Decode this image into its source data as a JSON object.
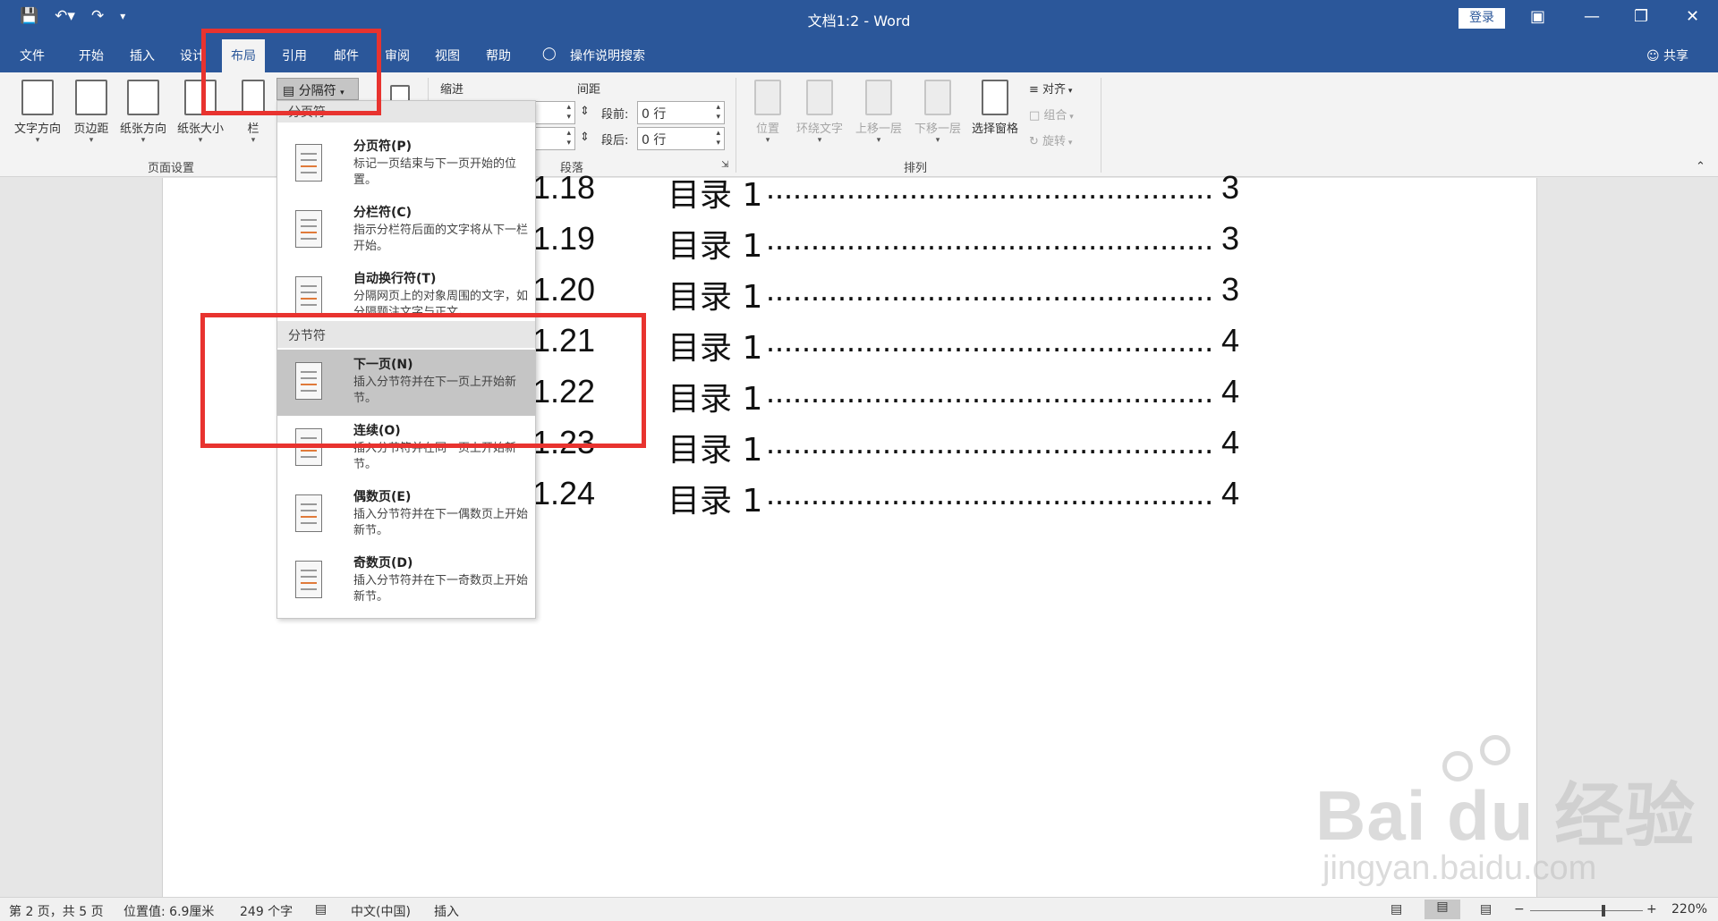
{
  "title_bar": {
    "doc_title": "文档1:2 - Word",
    "login_label": "登录",
    "qat_save_icon": "save-icon",
    "qat_undo_icon": "undo-icon",
    "qat_redo_icon": "redo-icon",
    "qat_customize_icon": "customize-icon",
    "ribbon_display_icon": "ribbon-display-icon",
    "minimize_icon": "minimize-icon",
    "restore_icon": "restore-icon",
    "close_icon": "close-icon"
  },
  "tabs": [
    {
      "label": "文件"
    },
    {
      "label": "开始"
    },
    {
      "label": "插入"
    },
    {
      "label": "设计"
    },
    {
      "label": "布局"
    },
    {
      "label": "引用"
    },
    {
      "label": "邮件"
    },
    {
      "label": "审阅"
    },
    {
      "label": "视图"
    },
    {
      "label": "帮助"
    },
    {
      "label": "操作说明搜索"
    }
  ],
  "active_tab": "布局",
  "share_label": "共享",
  "ribbon": {
    "page_setup": {
      "text_direction": "文字方向",
      "margins": "页边距",
      "orientation": "纸张方向",
      "size": "纸张大小",
      "columns": "栏",
      "group_label": "页面设置",
      "breaks_label": "分隔符"
    },
    "paragraph": {
      "indent_label": "缩进",
      "spacing_label": "间距",
      "before_label": "段前:",
      "after_label": "段后:",
      "before_value": "0 行",
      "after_value": "0 行",
      "group_label": "段落"
    },
    "arrange": {
      "position": "位置",
      "wrap_text": "环绕文字",
      "bring_forward": "上移一层",
      "send_backward": "下移一层",
      "selection_pane": "选择窗格",
      "align": "对齐",
      "group": "组合",
      "rotate": "旋转",
      "group_label": "排列"
    }
  },
  "breaks_menu": {
    "page_breaks_header": "分页符",
    "section_breaks_header": "分节符",
    "items": [
      {
        "title": "分页符(P)",
        "desc": "标记一页结束与下一页开始的位置。"
      },
      {
        "title": "分栏符(C)",
        "desc": "指示分栏符后面的文字将从下一栏开始。"
      },
      {
        "title": "自动换行符(T)",
        "desc": "分隔网页上的对象周围的文字，如分隔题注文字与正文。"
      },
      {
        "title": "下一页(N)",
        "desc": "插入分节符并在下一页上开始新节。"
      },
      {
        "title": "连续(O)",
        "desc": "插入分节符并在同一页上开始新节。"
      },
      {
        "title": "偶数页(E)",
        "desc": "插入分节符并在下一偶数页上开始新节。"
      },
      {
        "title": "奇数页(D)",
        "desc": "插入分节符并在下一奇数页上开始新节。"
      }
    ]
  },
  "document": {
    "toc_rows": [
      {
        "num": "1.18",
        "title": "目录 1",
        "dots": "...........................................................",
        "page": "3"
      },
      {
        "num": "1.19",
        "title": "目录 1",
        "dots": "...........................................................",
        "page": "3"
      },
      {
        "num": "1.20",
        "title": "目录 1",
        "dots": "...........................................................",
        "page": "3"
      },
      {
        "num": "1.21",
        "title": "目录 1",
        "dots": "...........................................................",
        "page": "4"
      },
      {
        "num": "1.22",
        "title": "目录 1",
        "dots": "...........................................................",
        "page": "4"
      },
      {
        "num": "1.23",
        "title": "目录 1",
        "dots": "...........................................................",
        "page": "4"
      },
      {
        "num": "1.24",
        "title": "目录 1",
        "dots": "...........................................................",
        "page": "4"
      }
    ]
  },
  "status_bar": {
    "page_info": "第 2 页，共 5 页",
    "position": "位置值: 6.9厘米",
    "word_count": "249 个字",
    "language": "中文(中国)",
    "mode": "插入",
    "zoom": "220%"
  },
  "watermark": {
    "brand": "Bai du 经验",
    "url": "jingyan.baidu.com"
  },
  "colors": {
    "word_blue": "#2b579a",
    "annotation_red": "#e8332f",
    "menu_highlight": "#c5c5c5"
  }
}
